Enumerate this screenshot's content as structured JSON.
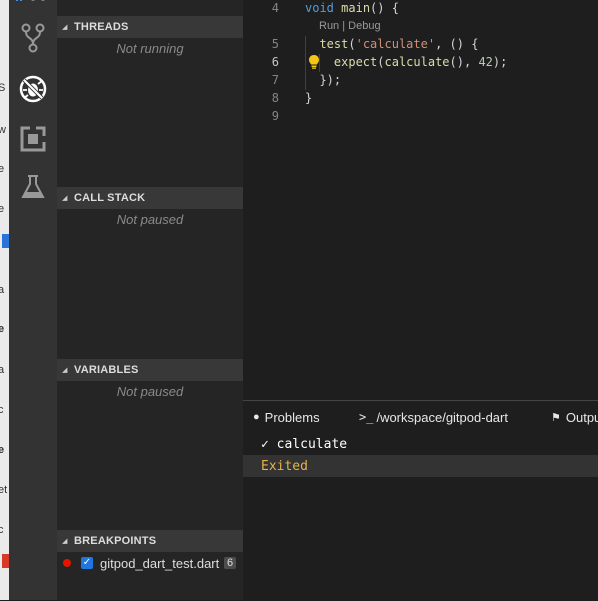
{
  "left_strip": {
    "glyphs": [
      "S",
      "w",
      "e",
      "e",
      "a",
      "e",
      "a",
      "c",
      "e",
      "et",
      "c"
    ]
  },
  "sidebar": {
    "sections": [
      {
        "id": "threads",
        "title": "THREADS",
        "empty": "Not running"
      },
      {
        "id": "call_stack",
        "title": "CALL STACK",
        "empty": "Not paused"
      },
      {
        "id": "variables",
        "title": "VARIABLES",
        "empty": "Not paused"
      },
      {
        "id": "breakpoints",
        "title": "BREAKPOINTS"
      }
    ],
    "breakpoint": {
      "file": "gitpod_dart_test.dart",
      "line": "6",
      "checked": true
    }
  },
  "editor": {
    "codelens": "Run | Debug",
    "lines": [
      {
        "num": "4",
        "tokens": [
          {
            "t": "void",
            "c": "kw"
          },
          {
            "t": " "
          },
          {
            "t": "main",
            "c": "fn"
          },
          {
            "t": "() {"
          }
        ]
      },
      {
        "num": "5",
        "tokens": [
          {
            "t": "  "
          },
          {
            "t": "test",
            "c": "fn"
          },
          {
            "t": "("
          },
          {
            "t": "'calculate'",
            "c": "str"
          },
          {
            "t": ", () {"
          }
        ]
      },
      {
        "num": "6",
        "tokens": [
          {
            "t": "    "
          },
          {
            "t": "expect",
            "c": "fn"
          },
          {
            "t": "("
          },
          {
            "t": "calculate",
            "c": "fn"
          },
          {
            "t": "(), "
          },
          {
            "t": "42",
            "c": "num"
          },
          {
            "t": ");"
          }
        ]
      },
      {
        "num": "7",
        "tokens": [
          {
            "t": "  });"
          }
        ]
      },
      {
        "num": "8",
        "tokens": [
          {
            "t": "}"
          }
        ]
      },
      {
        "num": "9",
        "tokens": []
      }
    ]
  },
  "panel": {
    "tabs": [
      {
        "label": "Problems",
        "icon": "info-circle-icon"
      },
      {
        "label": "/workspace/gitpod-dart",
        "icon": "terminal-icon"
      },
      {
        "label": "Output",
        "icon": "flag-icon"
      }
    ],
    "test_rows": [
      {
        "text": "✓ calculate",
        "color": "#ffffff"
      },
      {
        "text": "Exited",
        "color": "#e5b34a"
      }
    ]
  },
  "colors": {
    "activity_bar": "#333333",
    "sidebar": "#252526",
    "editor": "#1e1e1e",
    "breakpoint": "#e51400",
    "exited": "#e5b34a"
  }
}
